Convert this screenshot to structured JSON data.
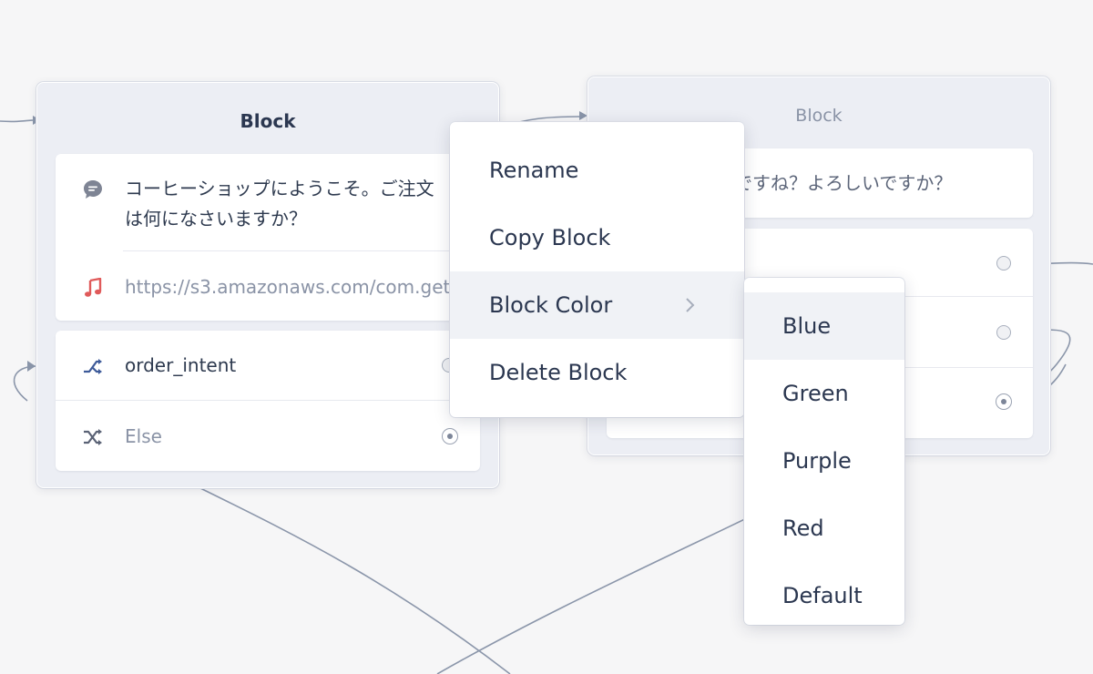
{
  "left_block": {
    "title": "Block",
    "message_text": "コーヒーショップにようこそ。ご注文は何になさいますか？",
    "message_line1": "コーヒーショップにようこそ。ご注文",
    "message_line2": "は何になさいますか？",
    "audio_url": "https://s3.amazonaws.com/com.get.",
    "intents": [
      {
        "label": "order_intent",
        "icon": "shuffle-icon"
      },
      {
        "label": "Else",
        "icon": "shuffle-else-icon"
      }
    ]
  },
  "right_block": {
    "title": "Block",
    "message_text": "ですね？よろしいですか？"
  },
  "context_menu": {
    "items": [
      {
        "label": "Rename"
      },
      {
        "label": "Copy Block"
      },
      {
        "label": "Block Color",
        "has_submenu": true
      },
      {
        "label": "Delete Block"
      }
    ]
  },
  "color_submenu": {
    "items": [
      {
        "label": "Blue"
      },
      {
        "label": "Green"
      },
      {
        "label": "Purple"
      },
      {
        "label": "Red"
      },
      {
        "label": "Default"
      }
    ]
  },
  "colors": {
    "canvas": "#f6f6f7",
    "block_bg": "#eceef4",
    "wire": "#8b96aa",
    "audio_icon": "#e05a5a",
    "intent_icon": "#3d5a99",
    "hover_bg": "#f0f2f6"
  }
}
